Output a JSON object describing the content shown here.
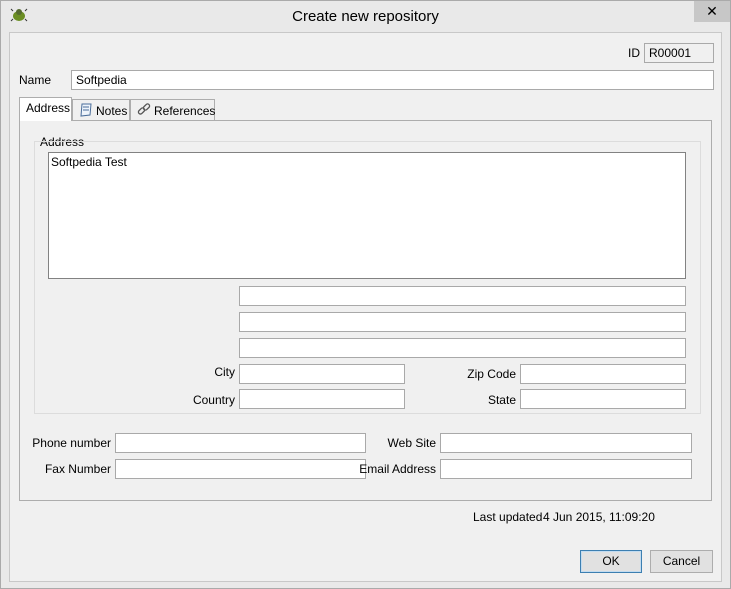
{
  "window": {
    "title": "Create new repository",
    "close_symbol": "✕"
  },
  "id_field": {
    "label": "ID",
    "value": "R00001"
  },
  "name_field": {
    "label": "Name",
    "value": "Softpedia"
  },
  "tabs": [
    {
      "label": "Address",
      "icon": "none",
      "active": true
    },
    {
      "label": "Notes",
      "icon": "notes-icon",
      "active": false
    },
    {
      "label": "References",
      "icon": "link-icon",
      "active": false
    }
  ],
  "address": {
    "group_label": "Address",
    "text": "Softpedia Test",
    "line1": "",
    "line2": "",
    "line3": "",
    "city_label": "City",
    "city": "",
    "zip_label": "Zip Code",
    "zip": "",
    "country_label": "Country",
    "country": "",
    "state_label": "State",
    "state": ""
  },
  "contact": {
    "phone_label": "Phone number",
    "phone": "",
    "website_label": "Web Site",
    "website": "",
    "fax_label": "Fax Number",
    "fax": "",
    "email_label": "Email Address",
    "email": ""
  },
  "last_updated": {
    "label": "Last updated",
    "value": "4 Jun 2015, 11:09:20"
  },
  "buttons": {
    "ok": "OK",
    "cancel": "Cancel"
  }
}
